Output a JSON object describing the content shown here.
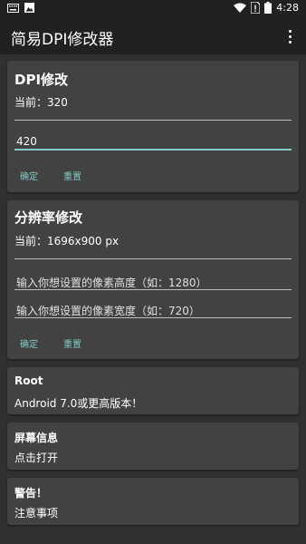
{
  "status_bar": {
    "time": "4:28",
    "icons": [
      "keyboard-icon",
      "image-icon",
      "wifi-icon",
      "sim-icon",
      "battery-icon"
    ]
  },
  "toolbar": {
    "title": "简易DPI修改器",
    "menu_icon": "overflow-menu-icon"
  },
  "dpi_card": {
    "title": "DPI修改",
    "current": "当前：320",
    "input_value": "420",
    "confirm_label": "确定",
    "reset_label": "重置"
  },
  "resolution_card": {
    "title": "分辨率修改",
    "current": "当前：1696x900 px",
    "height_placeholder": "输入你想设置的像素高度（如：1280）",
    "width_placeholder": "输入你想设置的像素宽度（如：720）",
    "confirm_label": "确定",
    "reset_label": "重置"
  },
  "root_card": {
    "title": "Root",
    "text": "Android 7.0或更高版本！"
  },
  "screen_info_card": {
    "title": "屏幕信息",
    "text": "点击打开"
  },
  "warning_card": {
    "title": "警告！",
    "text": "注意事项"
  },
  "colors": {
    "background": "#303030",
    "card": "#424242",
    "toolbar": "#212121",
    "accent": "#80cbc4"
  }
}
